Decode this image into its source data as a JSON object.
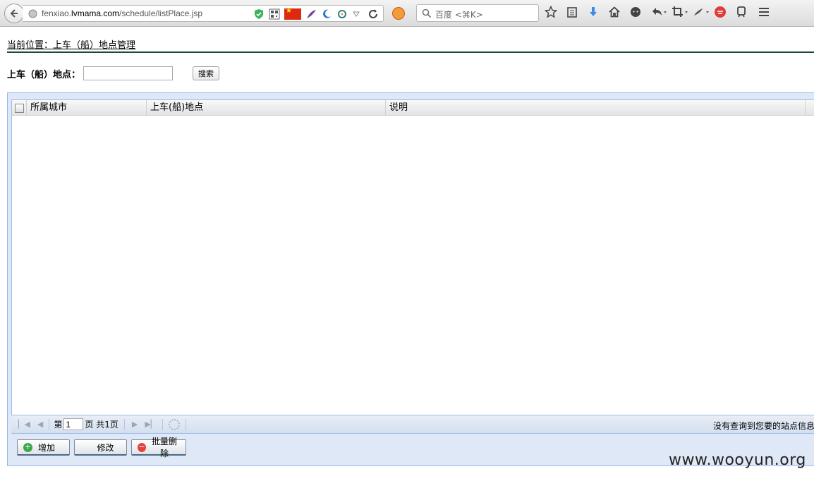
{
  "browser": {
    "url_prefix": "fenxiao.",
    "url_domain": "lvmama.com",
    "url_path": "/schedule/listPlace.jsp",
    "search_placeholder": "百度 <⌘K>"
  },
  "page": {
    "breadcrumb": "当前位置：上车（船）地点管理",
    "search_label": "上车（船）地点：",
    "search_value": "",
    "search_button": "搜索"
  },
  "grid": {
    "columns": [
      "所属城市",
      "上车(船)地点",
      "说明"
    ],
    "rows": []
  },
  "pager": {
    "page_prefix": "第",
    "page_value": "1",
    "page_suffix": "页 共1页",
    "message": "没有查询到您要的站点信息"
  },
  "actions": {
    "add": "增加",
    "edit": "修改",
    "batch_delete": "批量删除"
  },
  "watermark": "www.wooyun.org"
}
